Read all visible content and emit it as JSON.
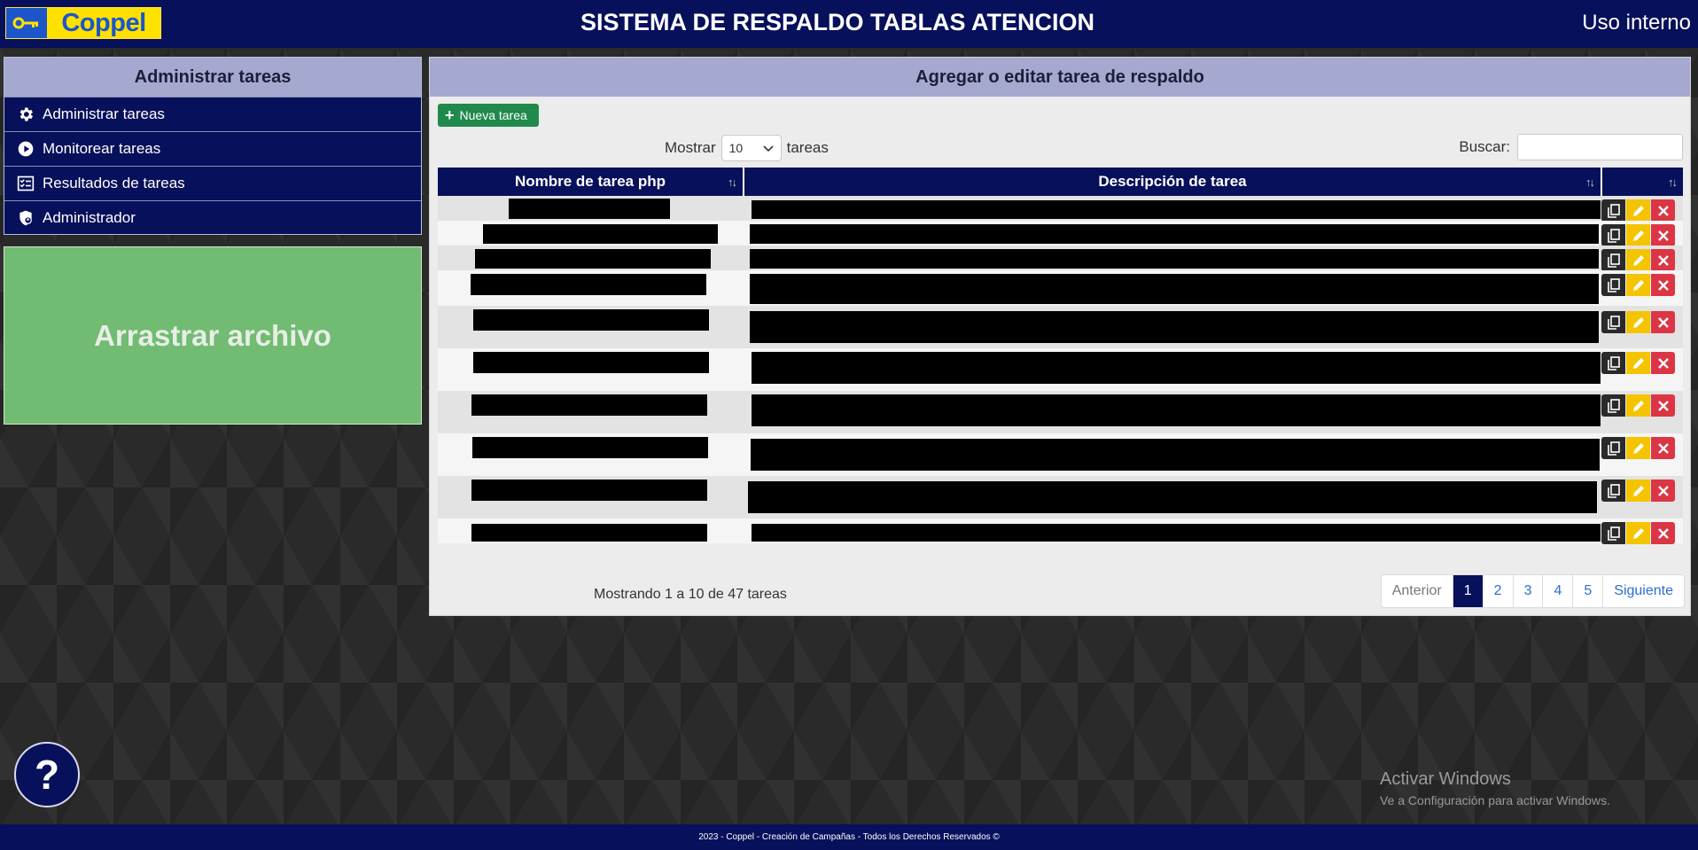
{
  "header": {
    "logo_text": "Coppel",
    "title": "SISTEMA DE RESPALDO TABLAS ATENCION",
    "right_label": "Uso interno"
  },
  "sidebar": {
    "title": "Administrar tareas",
    "items": [
      {
        "label": "Administrar tareas",
        "icon": "gear-icon"
      },
      {
        "label": "Monitorear tareas",
        "icon": "play-circle-icon"
      },
      {
        "label": "Resultados de tareas",
        "icon": "checklist-icon"
      },
      {
        "label": "Administrador",
        "icon": "shield-user-icon"
      }
    ]
  },
  "dropzone": {
    "label": "Arrastrar archivo"
  },
  "main": {
    "title": "Agregar o editar tarea de respaldo",
    "new_button": "Nueva tarea",
    "show_label": "Mostrar",
    "show_value": "10",
    "show_suffix": "tareas",
    "search_label": "Buscar:",
    "search_value": "",
    "columns": [
      "Nombre de tarea php",
      "Descripción de tarea",
      ""
    ],
    "info": "Mostrando 1 a 10 de 47 tareas",
    "pagination": [
      "Anterior",
      "1",
      "2",
      "3",
      "4",
      "5",
      "Siguiente"
    ],
    "active_page": "1"
  },
  "help_button": "?",
  "watermark": {
    "line1": "Activar Windows",
    "line2": "Ve a Configuración para activar Windows."
  },
  "footer": "2023 - Coppel - Creación de Campañas - Todos los Derechos Reservados ©",
  "colors": {
    "navy": "#07105a",
    "panel_header": "#a5a8cf",
    "dropzone": "#72bb72",
    "new_button": "#1f8a4c",
    "edit": "#f5c400",
    "delete": "#dc3545"
  }
}
